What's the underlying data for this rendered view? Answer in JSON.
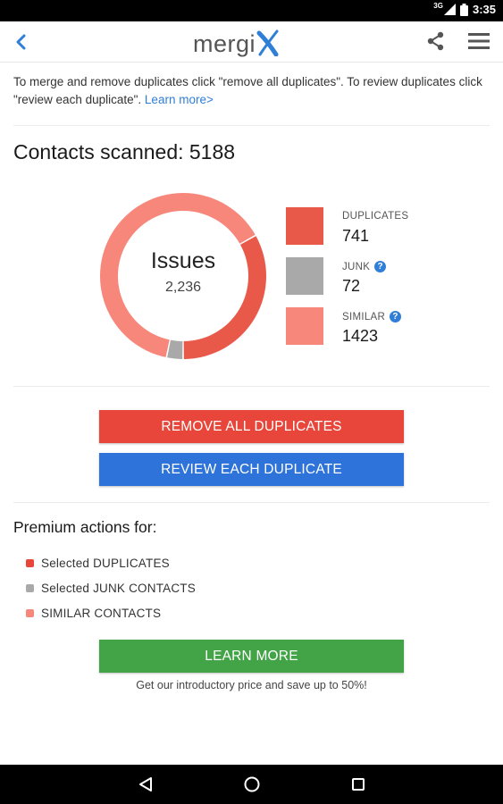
{
  "status_bar": {
    "network": "3G",
    "time": "3:35"
  },
  "app_bar": {
    "logo_text": "mergi",
    "logo_x_color": "#2f7ed8",
    "icons": [
      "back-arrow-icon",
      "share-icon",
      "menu-icon"
    ]
  },
  "intro": {
    "text": "To merge and remove duplicates click \"remove all duplicates\". To review duplicates click \"review each duplicate\". ",
    "link": "Learn more>"
  },
  "scanned": {
    "label": "Contacts scanned: 5188"
  },
  "issues": {
    "title": "Issues",
    "count": "2,236"
  },
  "legend": [
    {
      "label": "DUPLICATES",
      "value": "741",
      "color": "#e8594a",
      "help": false
    },
    {
      "label": "JUNK",
      "value": "72",
      "color": "#a9a9a9",
      "help": true
    },
    {
      "label": "SIMILAR",
      "value": "1423",
      "color": "#f7877b",
      "help": true
    }
  ],
  "chart_data": {
    "type": "pie",
    "title": "Issues",
    "total": 2236,
    "categories": [
      "DUPLICATES",
      "JUNK",
      "SIMILAR"
    ],
    "values": [
      741,
      72,
      1423
    ],
    "colors": [
      "#e8594a",
      "#a9a9a9",
      "#f7877b"
    ]
  },
  "buttons": {
    "remove_all": "REMOVE ALL DUPLICATES",
    "review_each": "REVIEW EACH DUPLICATE",
    "learn_more": "LEARN MORE"
  },
  "premium": {
    "title": "Premium actions for:",
    "items": [
      {
        "label": "Selected DUPLICATES",
        "color": "#e8463a"
      },
      {
        "label": "Selected JUNK CONTACTS",
        "color": "#a9a9a9"
      },
      {
        "label": "SIMILAR CONTACTS",
        "color": "#f7877b"
      }
    ]
  },
  "promo": {
    "text": "Get our introductory price and save up to 50%!"
  },
  "help_glyph": "?"
}
